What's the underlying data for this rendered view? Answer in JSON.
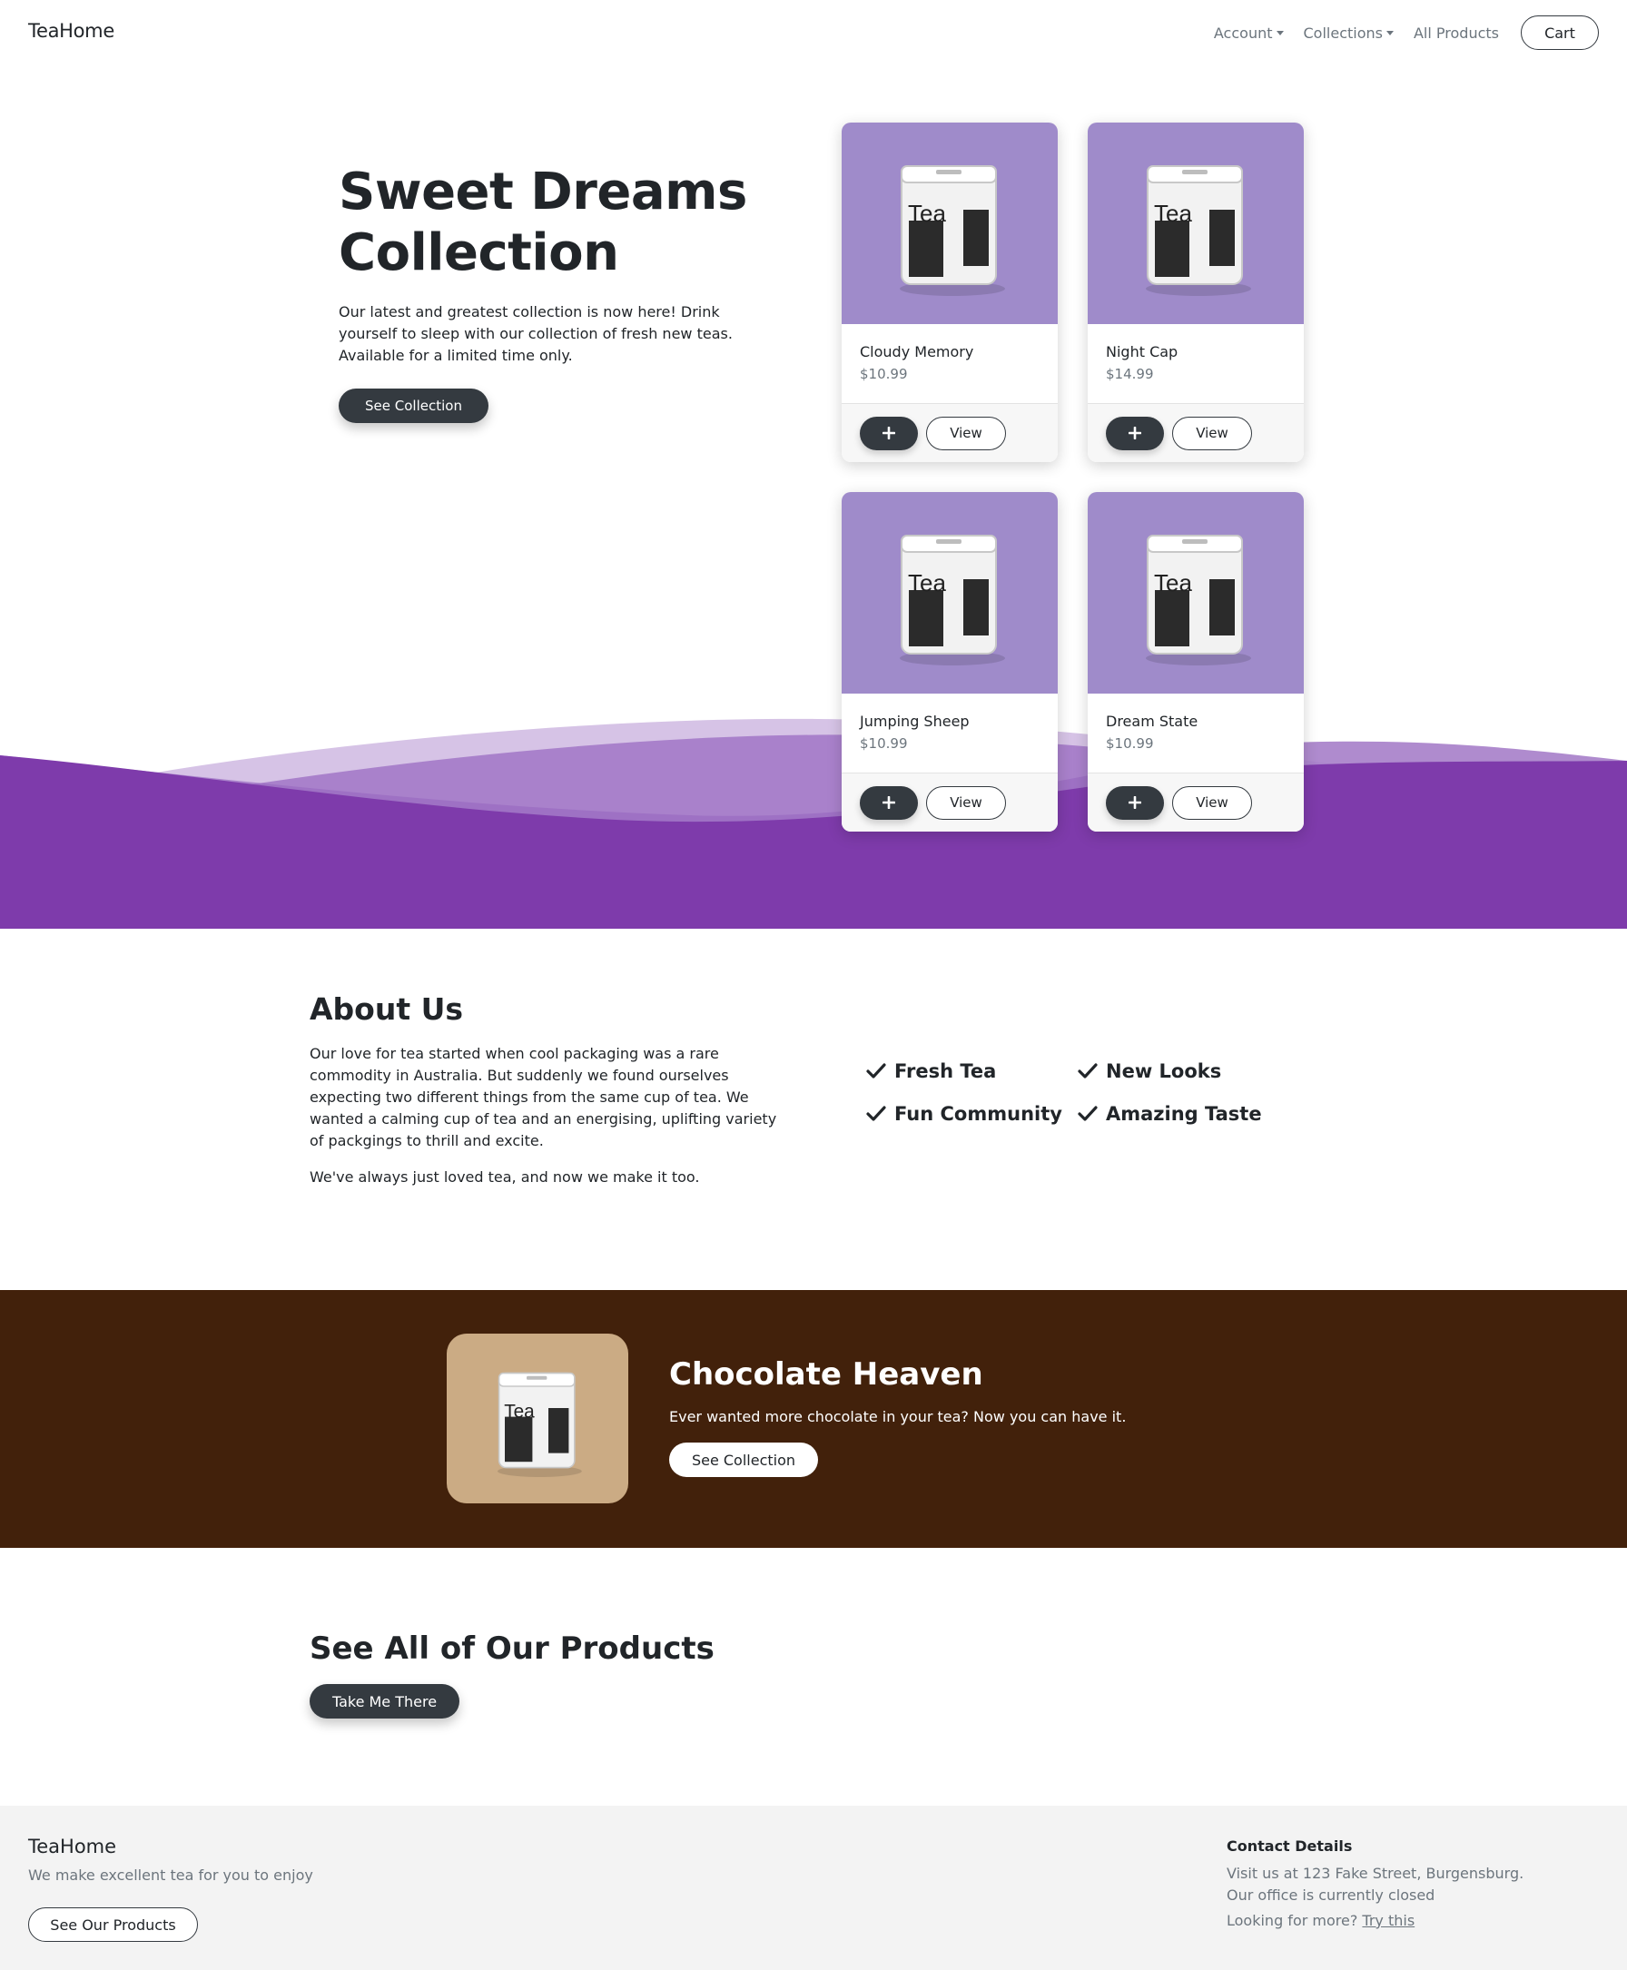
{
  "nav": {
    "brand": "TeaHome",
    "links": [
      {
        "label": "Account",
        "dropdown": true
      },
      {
        "label": "Collections",
        "dropdown": true
      },
      {
        "label": "All Products",
        "dropdown": false
      }
    ],
    "cart_label": "Cart"
  },
  "hero": {
    "title_line1": "Sweet Dreams",
    "title_line2": "Collection",
    "text": "Our latest and greatest collection is now here! Drink yourself to sleep with our collection of fresh new teas. Available for a limited time only.",
    "button": "See Collection"
  },
  "products": [
    {
      "name": "Cloudy Memory",
      "price": "$10.99",
      "view_label": "View"
    },
    {
      "name": "Night Cap",
      "price": "$14.99",
      "view_label": "View"
    },
    {
      "name": "Jumping Sheep",
      "price": "$10.99",
      "view_label": "View"
    },
    {
      "name": "Dream State",
      "price": "$10.99",
      "view_label": "View"
    }
  ],
  "tin_label": "Tea",
  "about": {
    "title": "About Us",
    "p1": "Our love for tea started when cool packaging was a rare commodity in Australia. But suddenly we found ourselves expecting two different things from the same cup of tea. We wanted a calming cup of tea and an energising, uplifting variety of packgings to thrill and excite.",
    "p2": "We've always just loved tea, and now we make it too.",
    "features": [
      "Fresh Tea",
      "New Looks",
      "Fun Community",
      "Amazing Taste"
    ]
  },
  "chocolate": {
    "title": "Chocolate Heaven",
    "text": "Ever wanted more chocolate in your tea? Now you can have it.",
    "button": "See Collection"
  },
  "see_all": {
    "title": "See All of Our Products",
    "button": "Take Me There"
  },
  "footer": {
    "brand": "TeaHome",
    "tagline": "We make excellent tea for you to enjoy",
    "button": "See Our Products",
    "contact_title": "Contact Details",
    "address": "Visit us at 123 Fake Street, Burgensburg.",
    "office_status": "Our office is currently closed",
    "more_text": "Looking for more?",
    "more_link": "Try this"
  },
  "colors": {
    "purple": "#7e3bab",
    "card_image_bg": "#9f8bca",
    "chocolate_bg": "#42210b",
    "chocolate_tile": "#cbab84",
    "dark_button": "#343a40",
    "footer_bg": "#f3f3f3"
  },
  "icons": [
    "caret-down-icon",
    "plus-icon",
    "check-icon",
    "tea-tin-image"
  ]
}
